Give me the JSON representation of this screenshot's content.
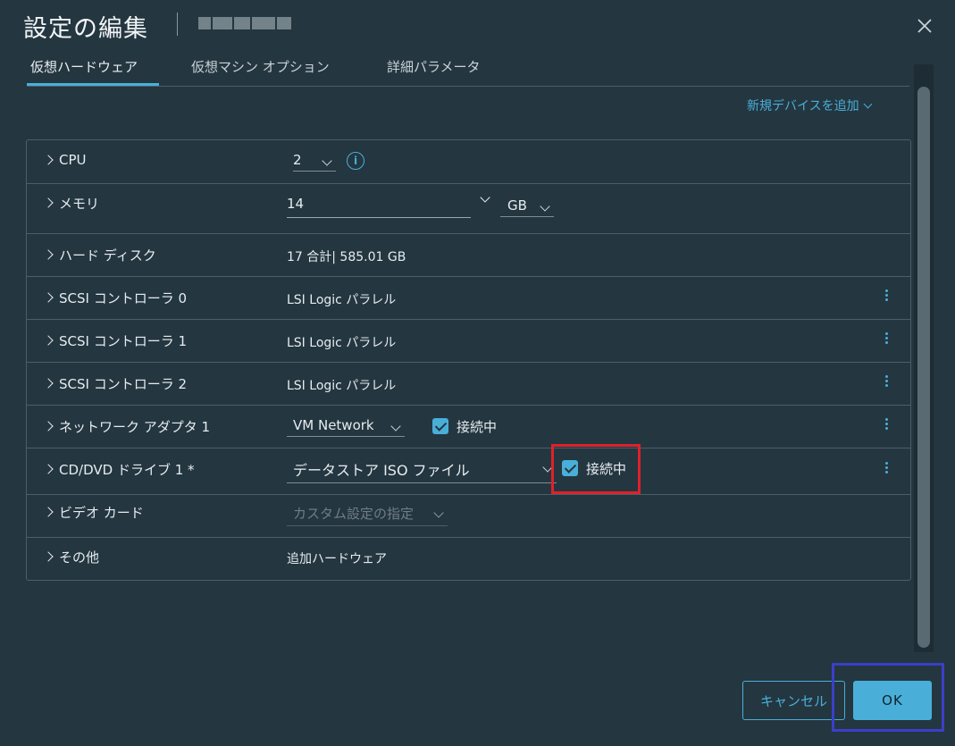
{
  "dialog": {
    "title": "設定の編集",
    "close_icon": "close-icon"
  },
  "tabs": [
    {
      "label": "仮想ハードウェア",
      "active": true
    },
    {
      "label": "仮想マシン オプション",
      "active": false
    },
    {
      "label": "詳細パラメータ",
      "active": false
    }
  ],
  "add_device": {
    "label": "新規デバイスを追加"
  },
  "rows": {
    "cpu": {
      "label": "CPU",
      "value": "2"
    },
    "memory": {
      "label": "メモリ",
      "value": "14",
      "unit": "GB"
    },
    "hard_disk": {
      "label": "ハード ディスク",
      "value": "17 合計| 585.01 GB"
    },
    "scsi0": {
      "label": "SCSI コントローラ 0",
      "value": "LSI Logic パラレル"
    },
    "scsi1": {
      "label": "SCSI コントローラ 1",
      "value": "LSI Logic パラレル"
    },
    "scsi2": {
      "label": "SCSI コントローラ 2",
      "value": "LSI Logic パラレル"
    },
    "network": {
      "label": "ネットワーク アダプタ 1",
      "value": "VM Network",
      "connected_label": "接続中",
      "connected": true
    },
    "cddvd": {
      "label": "CD/DVD ドライブ 1 *",
      "value": "データストア ISO ファイル",
      "connected_label": "接続中",
      "connected": true
    },
    "video": {
      "label": "ビデオ カード",
      "value": "カスタム設定の指定"
    },
    "other": {
      "label": "その他",
      "value": "追加ハードウェア"
    }
  },
  "footer": {
    "cancel_label": "キャンセル",
    "ok_label": "OK"
  },
  "colors": {
    "background": "#243640",
    "accent": "#49afd9",
    "highlight_red": "#e0202a",
    "highlight_blue": "#3b3fc8"
  }
}
